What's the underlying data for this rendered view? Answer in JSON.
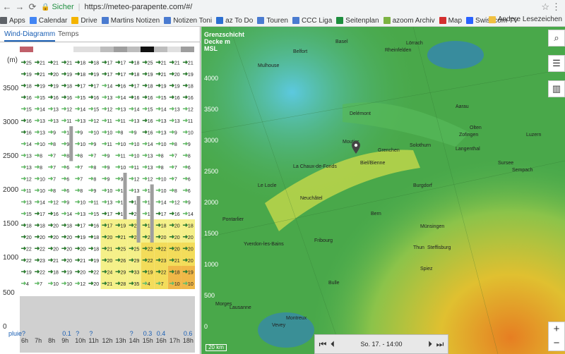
{
  "browser": {
    "secure_label": "Sicher",
    "url": "https://meteo-parapente.com/#/",
    "bookmarks": [
      {
        "label": "Apps",
        "color": "#5f6368"
      },
      {
        "label": "Calendar",
        "color": "#4285f4"
      },
      {
        "label": "Drive",
        "color": "#f4b400"
      },
      {
        "label": "Martins Notizen",
        "color": "#4a7bd0"
      },
      {
        "label": "Notizen Toni",
        "color": "#4a7bd0"
      },
      {
        "label": "az To Do",
        "color": "#2c6fd1"
      },
      {
        "label": "Touren",
        "color": "#4a7bd0"
      },
      {
        "label": "CCC Liga",
        "color": "#4a7bd0"
      },
      {
        "label": "Seitenplan",
        "color": "#1e8e3e"
      },
      {
        "label": "azoom Archiv",
        "color": "#7cb342"
      },
      {
        "label": "Map",
        "color": "#d32f2f"
      },
      {
        "label": "Swisscom TV",
        "color": "#2962ff"
      }
    ],
    "other_bookmarks": "Andere Lesezeichen"
  },
  "left_panel": {
    "tabs": [
      {
        "label": "Wind-Diagramm"
      },
      {
        "label": "Temps"
      }
    ],
    "unit": "(m)",
    "y_labels": [
      "3500",
      "3000",
      "2500",
      "2000",
      "1500",
      "1000",
      "500",
      "0"
    ],
    "hours": [
      "6h",
      "7h",
      "8h",
      "9h",
      "10h",
      "11h",
      "12h",
      "13h",
      "14h",
      "15h",
      "16h",
      "17h",
      "18h"
    ],
    "rain_label": "pluie",
    "rain": [
      "?",
      "",
      "",
      "0.1",
      "?",
      "?",
      "",
      "",
      "?",
      "0.3",
      "0.4",
      "",
      "0.6"
    ],
    "wind_speeds": [
      [
        "25",
        "21",
        "21",
        "21",
        "18",
        "18",
        "17",
        "17",
        "18"
      ],
      [
        "19",
        "21",
        "20",
        "19",
        "18",
        "19",
        "17",
        "17",
        "18"
      ],
      [
        "18",
        "19",
        "19",
        "18",
        "17",
        "17",
        "14",
        "16",
        "17"
      ],
      [
        "16",
        "15",
        "16",
        "16",
        "15",
        "16",
        "13",
        "14",
        "16"
      ],
      [
        "15",
        "14",
        "13",
        "12",
        "14",
        "15",
        "12",
        "13",
        "14"
      ],
      [
        "16",
        "13",
        "13",
        "11",
        "13",
        "12",
        "11",
        "11",
        "13"
      ],
      [
        "16",
        "13",
        "9",
        "10",
        "9",
        "10",
        "10",
        "8",
        "9"
      ],
      [
        "14",
        "10",
        "8",
        "9",
        "10",
        "9",
        "11",
        "10",
        "10"
      ],
      [
        "13",
        "8",
        "7",
        "8",
        "8",
        "7",
        "9",
        "11",
        "10"
      ],
      [
        "13",
        "8",
        "7",
        "6",
        "7",
        "8",
        "9",
        "10",
        "11"
      ],
      [
        "12",
        "10",
        "7",
        "6",
        "7",
        "8",
        "9",
        "9",
        "12"
      ],
      [
        "11",
        "10",
        "8",
        "6",
        "8",
        "9",
        "10",
        "11",
        "13"
      ],
      [
        "13",
        "14",
        "12",
        "9",
        "10",
        "11",
        "13",
        "13",
        "16"
      ],
      [
        "15",
        "17",
        "16",
        "14",
        "13",
        "15",
        "17",
        "17",
        "20"
      ],
      [
        "18",
        "18",
        "20",
        "18",
        "17",
        "16",
        "17",
        "19",
        "22"
      ],
      [
        "20",
        "20",
        "20",
        "20",
        "19",
        "18",
        "20",
        "21",
        "24"
      ],
      [
        "22",
        "22",
        "20",
        "20",
        "20",
        "18",
        "21",
        "25",
        "25"
      ],
      [
        "22",
        "23",
        "21",
        "20",
        "21",
        "19",
        "20",
        "26",
        "29"
      ],
      [
        "19",
        "22",
        "18",
        "19",
        "20",
        "22",
        "24",
        "29",
        "33"
      ],
      [
        "4",
        "7",
        "10",
        "10",
        "12",
        "20",
        "21",
        "28",
        "35"
      ]
    ]
  },
  "map": {
    "legend_title": "Grenzschicht Decke m MSL",
    "legend_values": [
      "4000",
      "3500",
      "3000",
      "2500",
      "2000",
      "1500",
      "1000",
      "500",
      "0"
    ],
    "scale_label": "20 km",
    "time_label": "So. 17. - 14:00",
    "towns": [
      "Belfort",
      "Mulhouse",
      "Basel",
      "Delémont",
      "Moutier",
      "Grenchen",
      "Solothurn",
      "Biel/Bienne",
      "La Chaux-de-Fonds",
      "Neuchâtel",
      "Le Locle",
      "Pontarlier",
      "Yverdon-les-Bains",
      "Fribourg",
      "Bern",
      "Thun",
      "Spiez",
      "Bulle",
      "Lausanne",
      "Morges",
      "Vevey",
      "Montreux",
      "Aarau",
      "Olten",
      "Zofingen",
      "Langenthal",
      "Burgdorf",
      "Luzern",
      "Sursee",
      "Sempach",
      "Rheinfelden",
      "Lörrach",
      "Münsingen",
      "Steffisburg"
    ]
  }
}
